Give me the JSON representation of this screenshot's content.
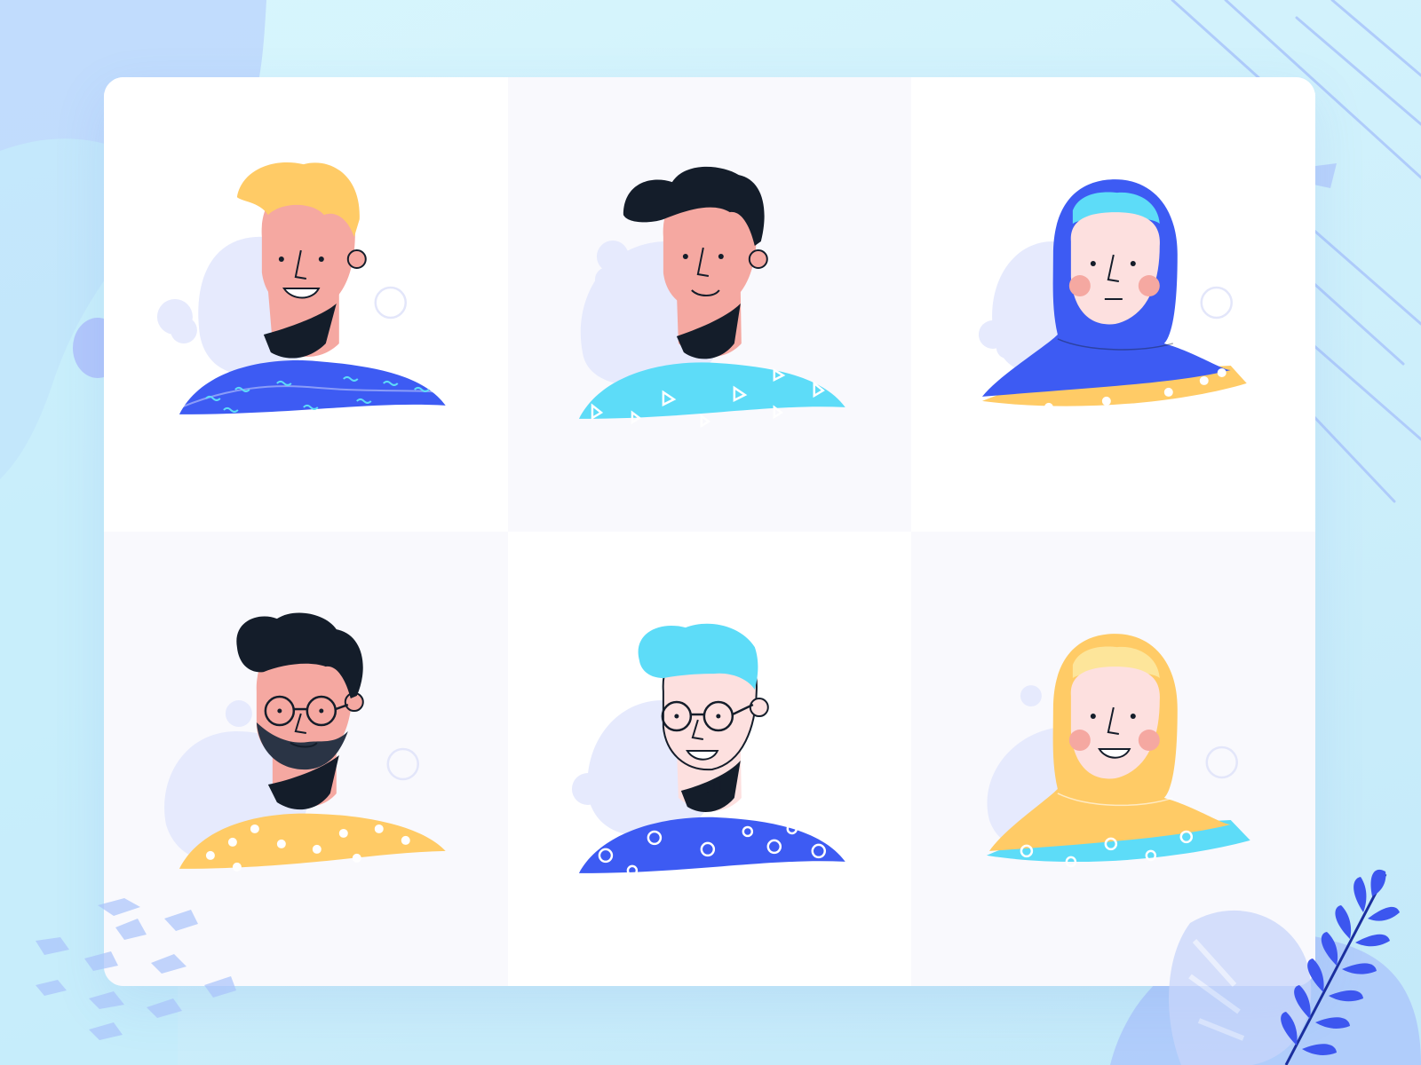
{
  "colors": {
    "page_background": "#d3f3fc",
    "card_background": "#ffffff",
    "cell_alt_background": "#f9f9fd",
    "skin": "#f5a8a1",
    "skin_light": "#fde0df",
    "hair_blonde": "#ffcb66",
    "hair_black": "#141d2a",
    "hair_cyan": "#5ddcf8",
    "shirt_blue": "#3d5bf3",
    "shirt_cyan": "#5ddcf8",
    "shirt_yellow": "#ffcb66",
    "blob": "#e6eafd",
    "accent_leaf": "#3c56ef"
  },
  "avatars": [
    {
      "id": "avatar-1",
      "description_key": "man-blonde-hair-blue-shirt",
      "hair": "blonde",
      "shirt_pattern": "squiggle",
      "shirt_color": "blue",
      "glasses": false,
      "hijab": false,
      "alt_bg": false
    },
    {
      "id": "avatar-2",
      "description_key": "man-black-hair-cyan-shirt",
      "hair": "black",
      "shirt_pattern": "triangle",
      "shirt_color": "cyan",
      "glasses": false,
      "hijab": false,
      "alt_bg": true
    },
    {
      "id": "avatar-3",
      "description_key": "woman-blue-hijab",
      "hair": "none",
      "shirt_pattern": "dots",
      "shirt_color": "yellow",
      "glasses": false,
      "hijab": true,
      "alt_bg": false
    },
    {
      "id": "avatar-4",
      "description_key": "man-black-hair-glasses-beard-yellow-shirt",
      "hair": "black",
      "shirt_pattern": "dots",
      "shirt_color": "yellow",
      "glasses": true,
      "hijab": false,
      "alt_bg": true
    },
    {
      "id": "avatar-5",
      "description_key": "man-cyan-hair-glasses-blue-shirt",
      "hair": "cyan",
      "shirt_pattern": "circle",
      "shirt_color": "blue",
      "glasses": true,
      "hijab": false,
      "alt_bg": false
    },
    {
      "id": "avatar-6",
      "description_key": "woman-yellow-hijab",
      "hair": "none",
      "shirt_pattern": "circle",
      "shirt_color": "cyan",
      "glasses": false,
      "hijab": true,
      "alt_bg": true
    }
  ]
}
